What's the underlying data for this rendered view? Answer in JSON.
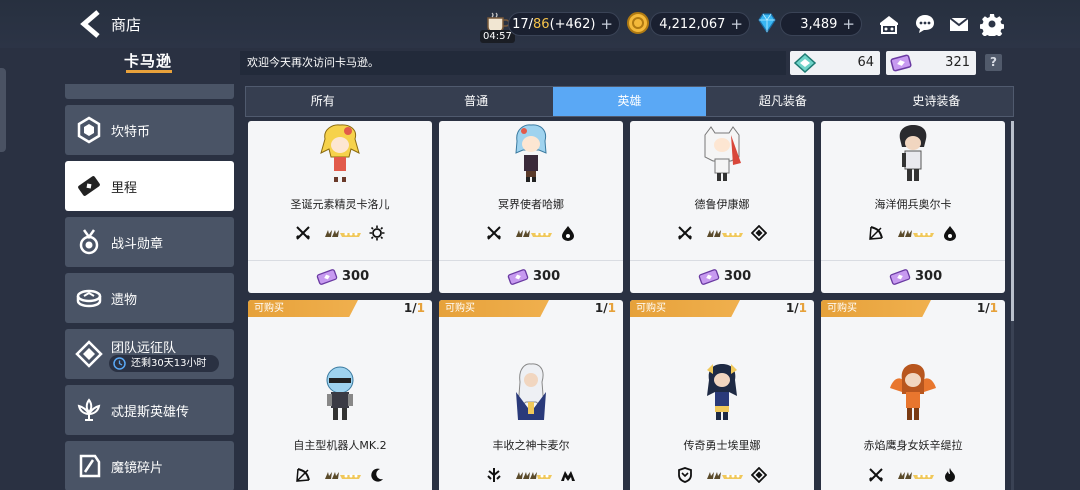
{
  "header": {
    "title": "商店",
    "stamina": {
      "current": "17/",
      "max": "86",
      "bonus": "(+462)",
      "timer": "04:57"
    },
    "gold": "4,212,067",
    "gems": "3,489",
    "plus": "+"
  },
  "shop": {
    "brand": "卡马逊",
    "welcome": "欢迎今天再次访问卡马逊。",
    "currency_a": "64",
    "currency_b": "321",
    "help": "?"
  },
  "sidebar": {
    "items": [
      {
        "label": "坎特币",
        "icon": "hex-coin-icon"
      },
      {
        "label": "里程",
        "icon": "ticket-icon"
      },
      {
        "label": "战斗勋章",
        "icon": "medal-icon"
      },
      {
        "label": "遗物",
        "icon": "relic-icon"
      },
      {
        "label": "团队远征队",
        "icon": "expedition-icon",
        "sub": "还剩30天13小时"
      },
      {
        "label": "忒提斯英雄传",
        "icon": "lotus-icon"
      },
      {
        "label": "魔镜碎片",
        "icon": "mirror-shard-icon"
      }
    ]
  },
  "tabs": [
    "所有",
    "普通",
    "英雄",
    "超凡装备",
    "史诗装备"
  ],
  "cards_top": [
    {
      "name": "圣诞元素精灵卡洛儿",
      "price": "300",
      "cls": "crossed-swords-icon",
      "elem": "light-icon"
    },
    {
      "name": "冥界使者哈娜",
      "price": "300",
      "cls": "crossed-swords-icon",
      "elem": "dark-icon"
    },
    {
      "name": "德鲁伊康娜",
      "price": "300",
      "cls": "crossed-swords-icon",
      "elem": "earth-icon"
    },
    {
      "name": "海洋佣兵奥尔卡",
      "price": "300",
      "cls": "bow-icon",
      "elem": "dark-icon"
    }
  ],
  "cards_bottom": [
    {
      "name": "自主型机器人MK.2",
      "tag": "可购买",
      "limit_a": "1/",
      "limit_b": "1",
      "cls": "bow-icon",
      "elem": "moon-icon"
    },
    {
      "name": "丰收之神卡麦尔",
      "tag": "可购买",
      "limit_a": "1/",
      "limit_b": "1",
      "cls": "support-icon",
      "elem": "basic-icon"
    },
    {
      "name": "传奇勇士埃里娜",
      "tag": "可购买",
      "limit_a": "1/",
      "limit_b": "1",
      "cls": "shield-icon",
      "elem": "earth-icon"
    },
    {
      "name": "赤焰鹰身女妖辛缇拉",
      "tag": "可购买",
      "limit_a": "1/",
      "limit_b": "1",
      "cls": "crossed-swords-icon",
      "elem": "fire-icon"
    }
  ],
  "colors": {
    "accent": "#5aa8f5",
    "tag": "#e6a13a",
    "gold": "#f4c24a"
  }
}
